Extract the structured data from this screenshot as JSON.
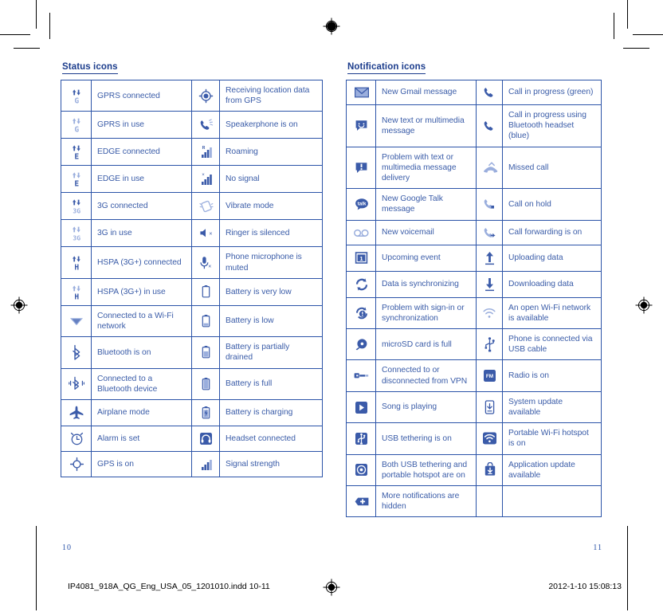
{
  "document": {
    "page_left_number": "10",
    "page_right_number": "11",
    "imprint_file": "IP4081_918A_QG_Eng_USA_05_1201010.indd   10-11",
    "imprint_date": "2012-1-10   15:08:13"
  },
  "sections": [
    {
      "id": "status-icons",
      "title": "Status icons",
      "rows": [
        {
          "left": {
            "icon": "gprs-connected-icon",
            "label": "GPRS connected"
          },
          "right": {
            "icon": "gps-location-icon",
            "label": "Receiving location data from GPS"
          }
        },
        {
          "left": {
            "icon": "gprs-in-use-icon",
            "label": "GPRS in use"
          },
          "right": {
            "icon": "speakerphone-icon",
            "label": "Speakerphone is on"
          }
        },
        {
          "left": {
            "icon": "edge-connected-icon",
            "label": "EDGE connected"
          },
          "right": {
            "icon": "roaming-icon",
            "label": "Roaming"
          }
        },
        {
          "left": {
            "icon": "edge-in-use-icon",
            "label": "EDGE in use"
          },
          "right": {
            "icon": "no-signal-icon",
            "label": "No signal"
          }
        },
        {
          "left": {
            "icon": "3g-connected-icon",
            "label": "3G connected"
          },
          "right": {
            "icon": "vibrate-mode-icon",
            "label": "Vibrate mode"
          }
        },
        {
          "left": {
            "icon": "3g-in-use-icon",
            "label": "3G in use"
          },
          "right": {
            "icon": "ringer-silenced-icon",
            "label": "Ringer is silenced"
          }
        },
        {
          "left": {
            "icon": "hspa-connected-icon",
            "label": "HSPA (3G+) connected"
          },
          "right": {
            "icon": "microphone-muted-icon",
            "label": "Phone microphone is muted"
          }
        },
        {
          "left": {
            "icon": "hspa-in-use-icon",
            "label": "HSPA (3G+) in use"
          },
          "right": {
            "icon": "battery-very-low-icon",
            "label": "Battery is very low"
          }
        },
        {
          "left": {
            "icon": "wifi-connected-icon",
            "label": "Connected to a Wi-Fi network"
          },
          "right": {
            "icon": "battery-low-icon",
            "label": "Battery is low"
          }
        },
        {
          "left": {
            "icon": "bluetooth-on-icon",
            "label": "Bluetooth is on"
          },
          "right": {
            "icon": "battery-partial-icon",
            "label": "Battery is partially drained"
          }
        },
        {
          "left": {
            "icon": "bluetooth-connected-icon",
            "label": "Connected to a Bluetooth device"
          },
          "right": {
            "icon": "battery-full-icon",
            "label": "Battery is full"
          }
        },
        {
          "left": {
            "icon": "airplane-mode-icon",
            "label": "Airplane mode"
          },
          "right": {
            "icon": "battery-charging-icon",
            "label": "Battery is charging"
          }
        },
        {
          "left": {
            "icon": "alarm-icon",
            "label": "Alarm is set"
          },
          "right": {
            "icon": "headset-icon",
            "label": "Headset connected"
          }
        },
        {
          "left": {
            "icon": "gps-on-icon",
            "label": "GPS is on"
          },
          "right": {
            "icon": "signal-strength-icon",
            "label": "Signal strength"
          }
        }
      ]
    },
    {
      "id": "notification-icons",
      "title": "Notification icons",
      "rows": [
        {
          "left": {
            "icon": "gmail-icon",
            "label": "New Gmail message"
          },
          "right": {
            "icon": "call-in-progress-icon",
            "label": "Call in progress (green)"
          }
        },
        {
          "left": {
            "icon": "new-message-icon",
            "label": "New text or multimedia message"
          },
          "right": {
            "icon": "call-bluetooth-icon",
            "label": "Call in progress using Bluetooth headset (blue)"
          }
        },
        {
          "left": {
            "icon": "message-problem-icon",
            "label": "Problem with text or multimedia message delivery"
          },
          "right": {
            "icon": "missed-call-icon",
            "label": "Missed call"
          }
        },
        {
          "left": {
            "icon": "google-talk-icon",
            "label": "New Google Talk message"
          },
          "right": {
            "icon": "call-on-hold-icon",
            "label": "Call on hold"
          }
        },
        {
          "left": {
            "icon": "voicemail-icon",
            "label": "New voicemail"
          },
          "right": {
            "icon": "call-forwarding-icon",
            "label": "Call forwarding is on"
          }
        },
        {
          "left": {
            "icon": "calendar-event-icon",
            "label": "Upcoming event"
          },
          "right": {
            "icon": "upload-icon",
            "label": "Uploading data"
          }
        },
        {
          "left": {
            "icon": "sync-icon",
            "label": "Data is synchronizing"
          },
          "right": {
            "icon": "download-icon",
            "label": "Downloading data"
          }
        },
        {
          "left": {
            "icon": "sync-problem-icon",
            "label": "Problem with sign-in or synchronization"
          },
          "right": {
            "icon": "open-wifi-icon",
            "label": "An open Wi-Fi network is available"
          }
        },
        {
          "left": {
            "icon": "sdcard-full-icon",
            "label": "microSD card is full"
          },
          "right": {
            "icon": "usb-cable-icon",
            "label": "Phone is connected via USB cable"
          }
        },
        {
          "left": {
            "icon": "vpn-icon",
            "label": "Connected to or disconnected from VPN"
          },
          "right": {
            "icon": "fm-radio-icon",
            "label": "Radio is on"
          }
        },
        {
          "left": {
            "icon": "play-icon",
            "label": "Song is playing"
          },
          "right": {
            "icon": "system-update-icon",
            "label": "System update available"
          }
        },
        {
          "left": {
            "icon": "usb-tethering-icon",
            "label": "USB tethering is on"
          },
          "right": {
            "icon": "wifi-hotspot-icon",
            "label": "Portable Wi-Fi hotspot is on"
          }
        },
        {
          "left": {
            "icon": "tethering-hotspot-icon",
            "label": "Both USB tethering and portable hotspot are on"
          },
          "right": {
            "icon": "app-update-icon",
            "label": "Application update available"
          }
        },
        {
          "left": {
            "icon": "more-notifications-icon",
            "label": "More notifications are hidden"
          },
          "right": {
            "icon": "",
            "label": ""
          }
        }
      ]
    }
  ],
  "colors": {
    "heading": "#1b3c8c",
    "body_text": "#3a5ca8",
    "table_border": "#2b53a8",
    "icon_dark": "#3b5ba9",
    "icon_light": "#9aaedd"
  }
}
